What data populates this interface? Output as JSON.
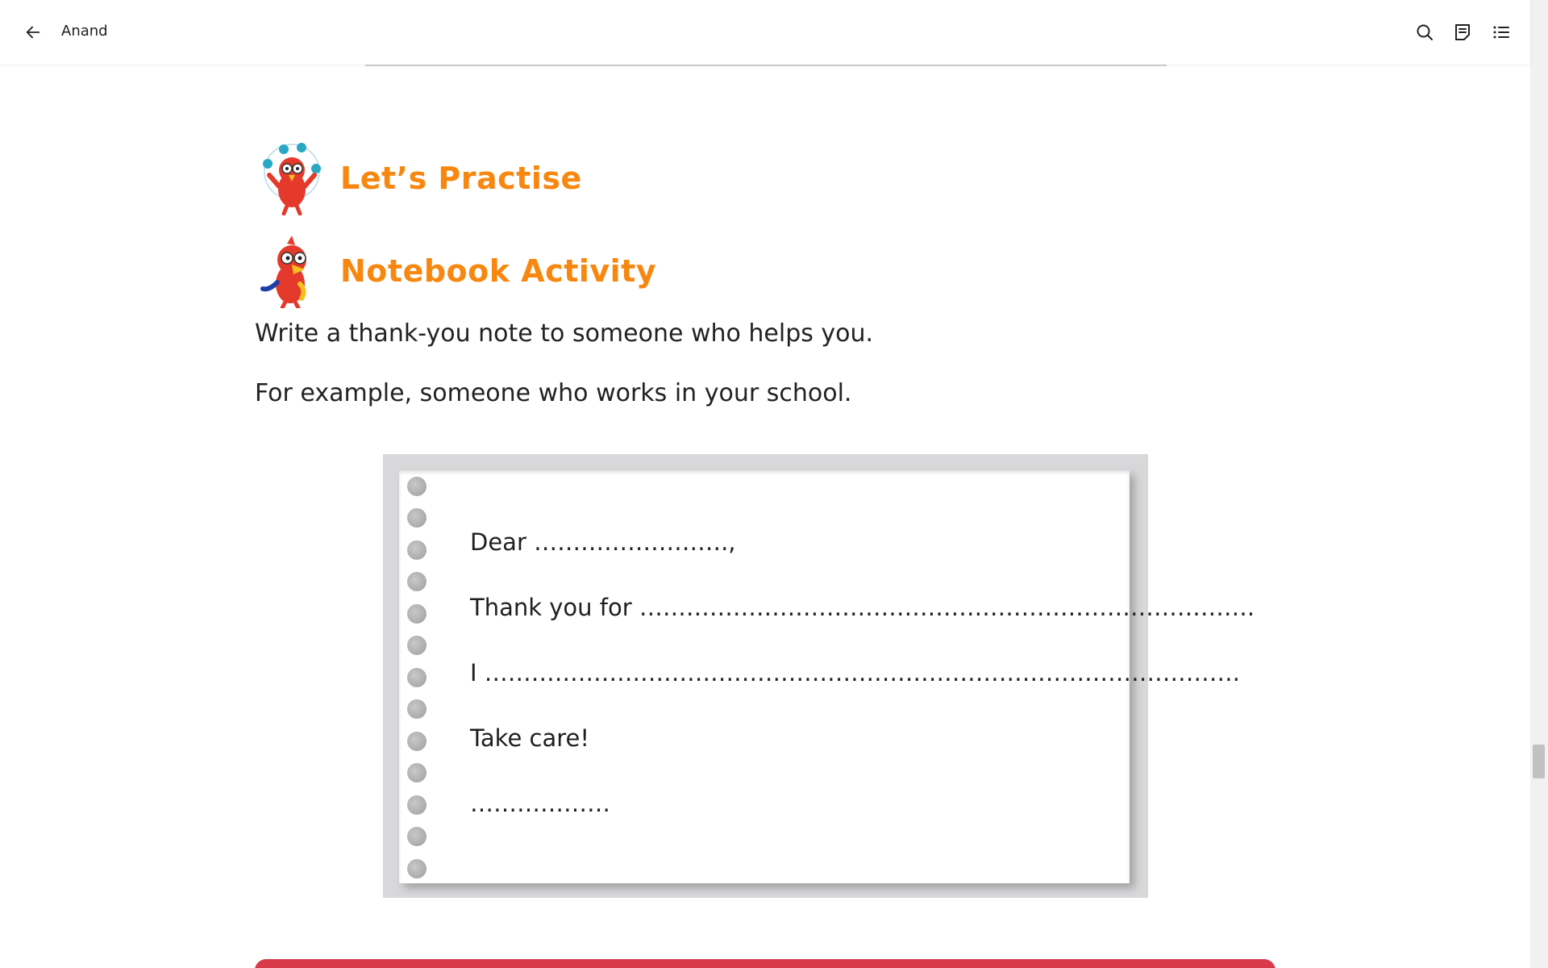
{
  "header": {
    "back_label": "Back",
    "book_title": "Anand",
    "tools": {
      "search": "search-icon",
      "notes": "notes-icon",
      "contents": "list-icon"
    }
  },
  "sections": {
    "practise_heading": "Let’s Practise",
    "notebook_heading": "Notebook Activity"
  },
  "paragraphs": [
    "Write a thank-you note to someone who helps you.",
    "For example, someone who works in your school."
  ],
  "note": {
    "line1": "Dear …………………….,",
    "line2": "Thank you for …………………………………………………………………….",
    "line3": "I …………………………………………………………………………………….",
    "line4": "Take care!",
    "line5": "………………"
  },
  "colors": {
    "heading_orange": "#f7870f",
    "next_block_red": "#d83a4a",
    "frame_gray": "#d8d8da"
  }
}
